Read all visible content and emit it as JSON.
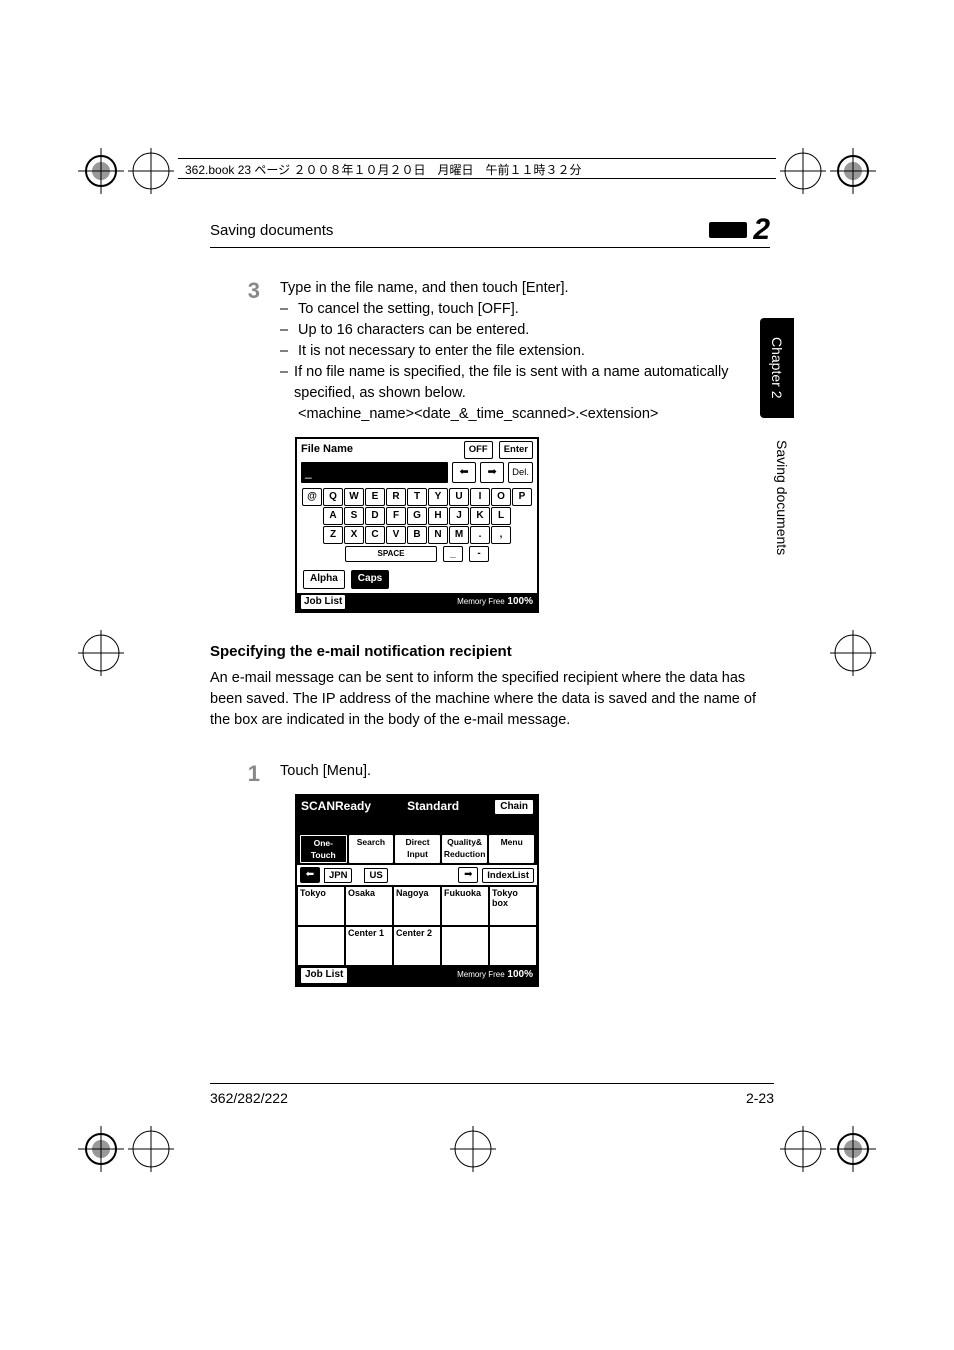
{
  "crop": {
    "line1": "362.book  23 ページ  ２００８年１０月２０日　月曜日　午前１１時３２分"
  },
  "running_head": {
    "left": "Saving documents",
    "chapter_num": "2"
  },
  "side": {
    "tab": "Chapter 2",
    "text": "Saving documents"
  },
  "step3": {
    "num": "3",
    "lead": "Type in the file name, and then touch [Enter].",
    "b1": "To cancel the setting, touch [OFF].",
    "b2": "Up to 16 characters can be entered.",
    "b3": "It is not necessary to enter the file extension.",
    "b4": "If no file name is specified, the file is sent with a name automatically specified, as shown below.",
    "fmt": "<machine_name><date_&_time_scanned>.<extension>"
  },
  "panelK": {
    "title": "File Name",
    "off": "OFF",
    "enter": "Enter",
    "value": "_",
    "del": "Del.",
    "row1": [
      "@",
      "Q",
      "W",
      "E",
      "R",
      "T",
      "Y",
      "U",
      "I",
      "O",
      "P"
    ],
    "row2": [
      "A",
      "S",
      "D",
      "F",
      "G",
      "H",
      "J",
      "K",
      "L"
    ],
    "row3": [
      "Z",
      "X",
      "C",
      "V",
      "B",
      "N",
      "M",
      ".",
      ","
    ],
    "space": "SPACE",
    "under": "_",
    "hyph": "-",
    "alpha": "Alpha",
    "caps": "Caps",
    "joblist": "Job List",
    "memlabel": "Memory Free",
    "mempct": "100%"
  },
  "section2": {
    "head": "Specifying the e-mail notification recipient",
    "para": "An e-mail message can be sent to inform the specified recipient where the data has been saved. The IP address of the machine where the data is saved and the name of the box are indicated in the body of the e-mail message."
  },
  "step1": {
    "num": "1",
    "lead": "Touch [Menu]."
  },
  "panelS": {
    "scan": "SCAN",
    "ready": "Ready",
    "standard": "Standard",
    "chain": "Chain",
    "tabs": [
      "One-Touch",
      "Search",
      "Direct Input",
      "Quality& Reduction",
      "Menu"
    ],
    "jpn": "JPN",
    "us": "US",
    "index": "IndexList",
    "cells": [
      "Tokyo",
      "Osaka",
      "Nagoya",
      "Fukuoka",
      "Tokyo box",
      "",
      "Center 1",
      "Center 2",
      "",
      ""
    ],
    "joblist": "Job List",
    "memlabel": "Memory Free",
    "mempct": "100%"
  },
  "footer": {
    "left": "362/282/222",
    "right": "2-23"
  }
}
